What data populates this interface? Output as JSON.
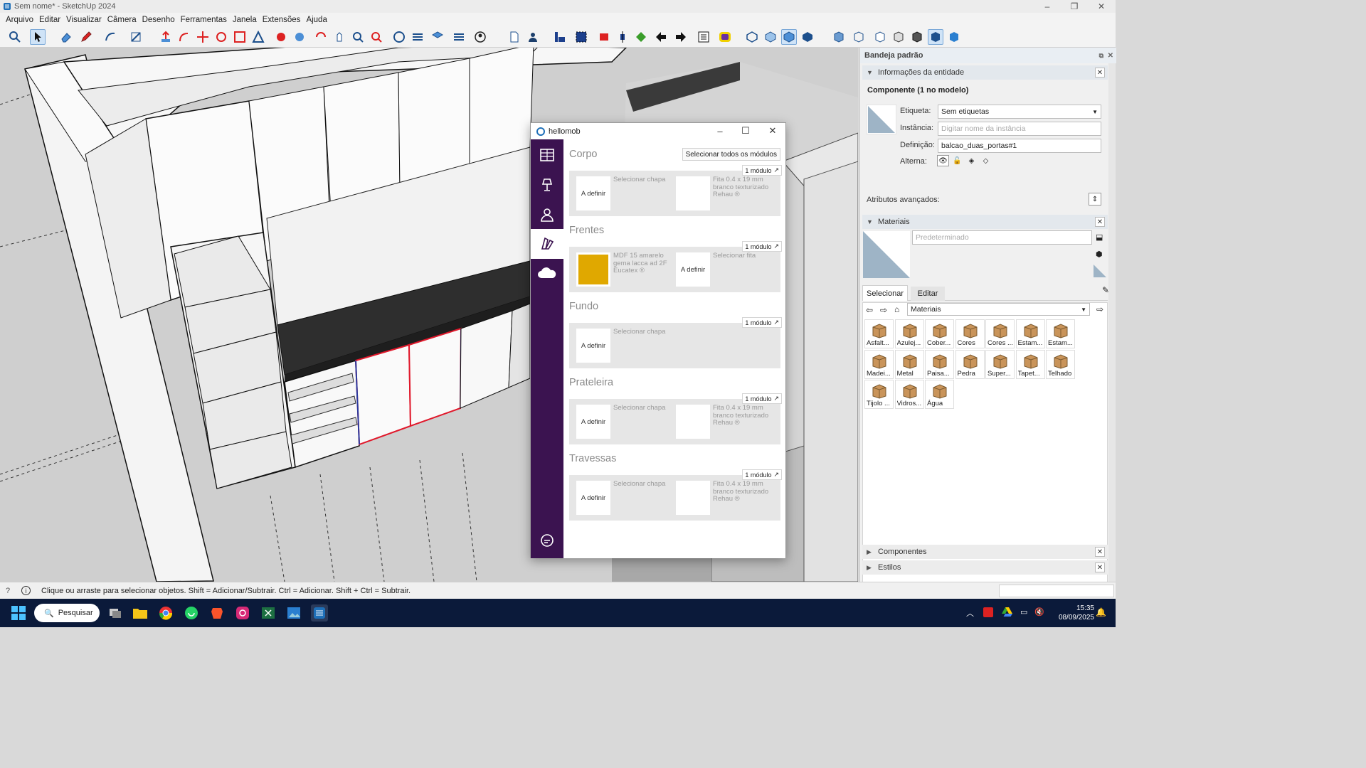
{
  "window": {
    "title": "Sem nome* - SketchUp 2024"
  },
  "menu": [
    "Arquivo",
    "Editar",
    "Visualizar",
    "Câmera",
    "Desenho",
    "Ferramentas",
    "Janela",
    "Extensões",
    "Ajuda"
  ],
  "plugin": {
    "title": "hellomob",
    "select_all_label": "Selecionar todos os módulos",
    "sections": [
      {
        "title": "Corpo",
        "badge": "1 módulo",
        "box1": "A definir",
        "label1": "Selecionar chapa",
        "label2": "Fita 0.4 x 19 mm branco texturizado Rehau ®"
      },
      {
        "title": "Frentes",
        "badge": "1 módulo",
        "box1_color": "#e0a800",
        "label1": "MDF 15 amarelo gema lacca ad 2F Eucatex ®",
        "box2": "A definir",
        "label2": "Selecionar fita"
      },
      {
        "title": "Fundo",
        "badge": "1 módulo",
        "box1": "A definir",
        "label1": "Selecionar chapa"
      },
      {
        "title": "Prateleira",
        "badge": "1 módulo",
        "box1": "A definir",
        "label1": "Selecionar chapa",
        "label2": "Fita 0.4 x 19 mm branco texturizado Rehau ®"
      },
      {
        "title": "Travessas",
        "badge": "1 módulo",
        "box1": "A definir",
        "label1": "Selecionar chapa",
        "label2": "Fita 0.4 x 19 mm branco texturizado Rehau ®"
      }
    ]
  },
  "tray": {
    "title": "Bandeja padrão",
    "entity_panel": {
      "header": "Informações da entidade",
      "heading": "Componente (1 no modelo)",
      "tag_label": "Etiqueta:",
      "tag_value": "Sem etiquetas",
      "instance_label": "Instância:",
      "instance_placeholder": "Digitar nome da instância",
      "definition_label": "Definição:",
      "definition_value": "balcao_duas_portas#1",
      "toggle_label": "Alterna:",
      "advanced_label": "Atributos avançados:"
    },
    "materials_panel": {
      "header": "Materiais",
      "name_placeholder": "Predeterminado",
      "tab_select": "Selecionar",
      "tab_edit": "Editar",
      "library": "Materiais",
      "items": [
        "Asfalt...",
        "Azulej...",
        "Cober...",
        "Cores",
        "Cores ...",
        "Estam...",
        "Estam...",
        "Madei...",
        "Metal",
        "Paisa...",
        "Pedra",
        "Super...",
        "Tapet...",
        "Telhado",
        "Tijolo ...",
        "Vidros...",
        "Água"
      ]
    },
    "components_panel": {
      "header": "Componentes"
    },
    "styles_panel": {
      "header": "Estilos"
    }
  },
  "status": {
    "message": "Clique ou arraste para selecionar objetos. Shift = Adicionar/Subtrair. Ctrl = Adicionar. Shift + Ctrl = Subtrair."
  },
  "taskbar": {
    "search_label": "Pesquisar",
    "time": "15:35",
    "date": "08/09/2025"
  },
  "colors": {
    "plugin_sidebar": "#3b1350",
    "selection": "#e0182b",
    "frente_swatch": "#e0a800",
    "taskbar": "#0b1a3a"
  }
}
